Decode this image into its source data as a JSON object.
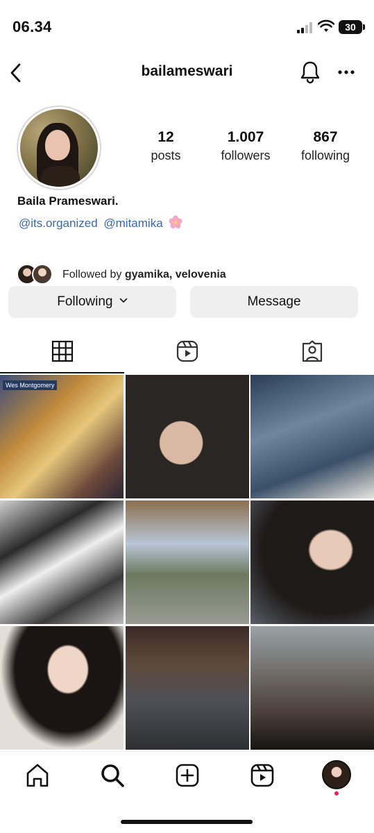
{
  "status_bar": {
    "time": "06.34",
    "battery": "30"
  },
  "header": {
    "username": "bailameswari"
  },
  "profile": {
    "stats": {
      "posts_value": "12",
      "posts_label": "posts",
      "followers_value": "1.007",
      "followers_label": "followers",
      "following_value": "867",
      "following_label": "following"
    },
    "full_name": "Baila Prameswari.",
    "bio_links": [
      "@its.organized",
      "@mitamika"
    ],
    "followed_by_prefix": "Followed by",
    "followed_by_names": "gyamika, velovenia"
  },
  "actions": {
    "following_label": "Following",
    "message_label": "Message"
  },
  "tabs": [
    "grid-posts",
    "reels",
    "tagged"
  ],
  "grid": {
    "posts": [
      {
        "label": "Wes Montgomery"
      },
      {
        "label": ""
      },
      {
        "label": ""
      },
      {
        "label": ""
      },
      {
        "label": ""
      },
      {
        "label": ""
      },
      {
        "label": ""
      },
      {
        "label": ""
      },
      {
        "label": ""
      }
    ]
  },
  "bottom_nav": [
    "home",
    "search",
    "create",
    "reels",
    "profile"
  ],
  "colors": {
    "link": "#3b68a8",
    "button_bg": "#efefef",
    "notification_dot": "#ee1d52"
  }
}
